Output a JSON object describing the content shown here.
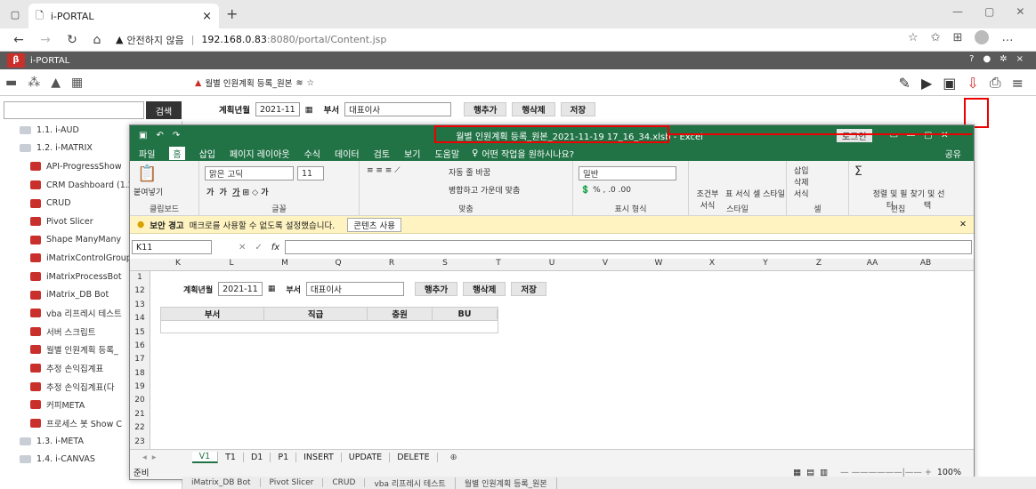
{
  "browser": {
    "tab_title": "i-PORTAL",
    "tab_close": "×",
    "new_tab": "+",
    "security_warning": "안전하지 않음",
    "url_host": "192.168.0.83",
    "url_rest": ":8080/portal/Content.jsp"
  },
  "app": {
    "title": "i-PORTAL",
    "logo_letter": "β",
    "search_button": "검색",
    "help_q": "?",
    "close_x": "×"
  },
  "sidebar": {
    "items": [
      {
        "label": "1.1. i-AUD",
        "type": "folder"
      },
      {
        "label": "1.2. i-MATRIX",
        "type": "folder"
      },
      {
        "label": "API-ProgressShow",
        "type": "item"
      },
      {
        "label": "CRM Dashboard (1.2",
        "type": "item"
      },
      {
        "label": "CRUD",
        "type": "item"
      },
      {
        "label": "Pivot Slicer",
        "type": "item"
      },
      {
        "label": "Shape ManyMany",
        "type": "item"
      },
      {
        "label": "iMatrixControlGroup",
        "type": "item"
      },
      {
        "label": "iMatrixProcessBot",
        "type": "item"
      },
      {
        "label": "iMatrix_DB Bot",
        "type": "item"
      },
      {
        "label": "vba 리프레시 테스트",
        "type": "item"
      },
      {
        "label": "서버 스크립트",
        "type": "item"
      },
      {
        "label": "월별 인원계획 등록_",
        "type": "item"
      },
      {
        "label": "추정 손익집계표",
        "type": "item"
      },
      {
        "label": "추정 손익집계표(다",
        "type": "item"
      },
      {
        "label": "커피META",
        "type": "item"
      },
      {
        "label": "프로세스 봇 Show C",
        "type": "item"
      },
      {
        "label": "1.3. i-META",
        "type": "folder"
      },
      {
        "label": "1.4. i-CANVAS",
        "type": "folder"
      }
    ]
  },
  "main": {
    "breadcrumb": "월별 인원계획 등록_원본",
    "labels": {
      "plan_month": "계획년월",
      "dept": "부서"
    },
    "month_value": "2021-11",
    "dept_value": "대표이사",
    "add_row": "행추가",
    "delete_row": "행삭제",
    "save": "저장"
  },
  "excel": {
    "title": "월별 인원계획 등록_원본_2021-11-19 17_16_34.xlsb  -  Excel",
    "login": "로그인",
    "menu": [
      "파일",
      "홈",
      "삽입",
      "페이지 레이아웃",
      "수식",
      "데이터",
      "검토",
      "보기",
      "도움말"
    ],
    "tell_me": "어떤 작업을 원하시나요?",
    "share": "공유",
    "ribbon": {
      "paste": "붙여넣기",
      "clipboard": "클립보드",
      "font_name": "맑은 고딕",
      "font_size": "11",
      "font_group": "글꼴",
      "wrap_text": "자동 줄 바꿈",
      "merge_center": "병합하고 가운데 맞춤",
      "align_group": "맞춤",
      "number_format": "일반",
      "number_group": "표시 형식",
      "cond_format": "조건부 서식",
      "table_format": "표 서식",
      "cell_style": "셀 스타일",
      "style_group": "스타일",
      "insert": "삽입",
      "delete": "삭제",
      "format": "서식",
      "cells_group": "셀",
      "sort_filter": "정렬 및 필터",
      "find_select": "찾기 및 선택",
      "edit_group": "편집"
    },
    "security": {
      "label": "보안 경고",
      "message": "매크로를 사용할 수 없도록 설정했습니다.",
      "enable": "콘텐츠 사용"
    },
    "name_box": "K11",
    "fx": "fx",
    "columns": [
      "K",
      "L",
      "M",
      "Q",
      "R",
      "S",
      "T",
      "U",
      "V",
      "W",
      "X",
      "Y",
      "Z",
      "AA",
      "AB"
    ],
    "rows": [
      "1",
      "12",
      "13",
      "14",
      "15",
      "16",
      "17",
      "18",
      "19",
      "20",
      "21",
      "22",
      "23"
    ],
    "sheet": {
      "plan_month": "계획년월",
      "month_value": "2021-11",
      "dept_label": "부서",
      "dept_value": "대표이사",
      "add_row": "행추가",
      "delete_row": "행삭제",
      "save": "저장",
      "table_headers": [
        "부서",
        "직급",
        "충원",
        "BU"
      ]
    },
    "sheet_tabs": [
      "V1",
      "T1",
      "D1",
      "P1",
      "INSERT",
      "UPDATE",
      "DELETE"
    ],
    "status_ready": "준비",
    "zoom": "100%"
  },
  "bottom_tabs": [
    "iMatrix_DB Bot",
    "Pivot Slicer",
    "CRUD",
    "vba 리프레시 테스트",
    "월별 인원계획 등록_원본"
  ],
  "colors": {
    "excel_green": "#217346",
    "accent_red": "#e00000",
    "app_bar": "#5a5a5a"
  }
}
